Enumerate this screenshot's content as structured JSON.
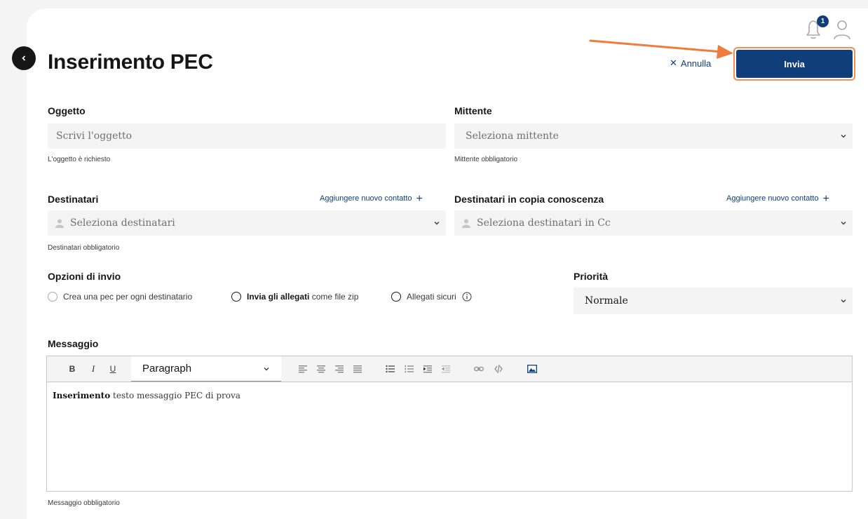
{
  "header": {
    "title": "Inserimento PEC",
    "notification_count": "1",
    "cancel_label": "Annulla",
    "send_label": "Invia"
  },
  "oggetto": {
    "label": "Oggetto",
    "placeholder": "Scrivi l'oggetto",
    "help": "L'oggetto è richiesto"
  },
  "mittente": {
    "label": "Mittente",
    "placeholder": "Seleziona mittente",
    "help": "Mittente obbligatorio"
  },
  "destinatari": {
    "label": "Destinatari",
    "add_link": "Aggiungere nuovo contatto",
    "placeholder": "Seleziona destinatari",
    "help": "Destinatari obbligatorio"
  },
  "destinatari_cc": {
    "label": "Destinatari in copia conoscenza",
    "add_link": "Aggiungere nuovo contatto",
    "placeholder": "Seleziona destinatari in Cc"
  },
  "opzioni": {
    "label": "Opzioni di invio",
    "option1": "Crea una pec per ogni destinatario",
    "option2_bold": "Invia gli allegati",
    "option2_rest": " come file zip",
    "option3": "Allegati sicuri"
  },
  "priorita": {
    "label": "Priorità",
    "value": "Normale"
  },
  "messaggio": {
    "label": "Messaggio",
    "format_value": "Paragraph",
    "body_bold": "Inserimento",
    "body_rest": " testo messaggio PEC di prova",
    "help": "Messaggio obbligatorio"
  },
  "toolbar": {
    "bold": "B",
    "italic": "I",
    "underline": "U"
  },
  "colors": {
    "primary": "#0f3e7a",
    "highlight": "#f28f52",
    "field_bg": "#f4f4f4"
  },
  "icons": [
    "back-icon",
    "bell-icon",
    "user-icon",
    "close-icon",
    "chevron-down-icon",
    "person-icon",
    "plus-icon",
    "info-icon",
    "align-left-icon",
    "align-center-icon",
    "align-right-icon",
    "align-justify-icon",
    "bullet-list-icon",
    "numbered-list-icon",
    "indent-icon",
    "outdent-icon",
    "link-icon",
    "unlink-icon",
    "image-icon"
  ]
}
